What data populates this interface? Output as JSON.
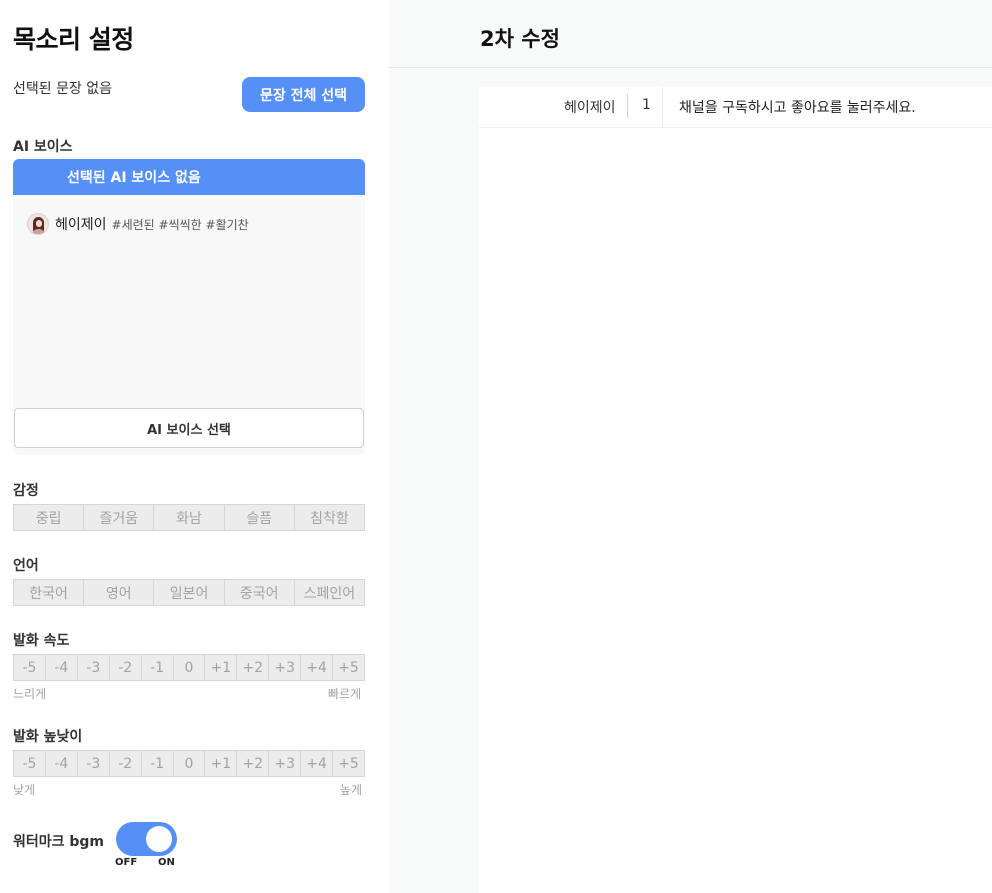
{
  "left_panel": {
    "title": "목소리 설정",
    "selected_sentence_text": "선택된 문장 없음",
    "select_all_button": "문장 전체 선택",
    "ai_voice": {
      "label": "AI 보이스",
      "selected_text": "선택된 AI 보이스 없음",
      "items": [
        {
          "name": "헤이제이",
          "tags": "#세련된 #씩씩한 #활기찬"
        }
      ],
      "select_button": "AI 보이스 선택"
    },
    "emotion": {
      "label": "감정",
      "options": [
        "중립",
        "즐거움",
        "화남",
        "슬픔",
        "침착함"
      ]
    },
    "language": {
      "label": "언어",
      "options": [
        "한국어",
        "영어",
        "일본어",
        "중국어",
        "스페인어"
      ]
    },
    "speed": {
      "label": "발화 속도",
      "options": [
        "-5",
        "-4",
        "-3",
        "-2",
        "-1",
        "0",
        "+1",
        "+2",
        "+3",
        "+4",
        "+5"
      ],
      "min_label": "느리게",
      "max_label": "빠르게"
    },
    "pitch": {
      "label": "발화 높낮이",
      "options": [
        "-5",
        "-4",
        "-3",
        "-2",
        "-1",
        "0",
        "+1",
        "+2",
        "+3",
        "+4",
        "+5"
      ],
      "min_label": "낮게",
      "max_label": "높게"
    },
    "watermark": {
      "label": "워터마크 bgm",
      "off_label": "OFF",
      "on_label": "ON",
      "state": "on"
    }
  },
  "right_panel": {
    "title": "2차 수정",
    "rows": [
      {
        "speaker": "헤이제이",
        "index": "1",
        "text": "채널을 구독하시고 좋아요를 눌러주세요."
      }
    ]
  },
  "colors": {
    "accent": "#5590f6",
    "segment_bg": "#ececec",
    "segment_text": "#a3a3a3",
    "right_bg": "#f8f9f9"
  }
}
